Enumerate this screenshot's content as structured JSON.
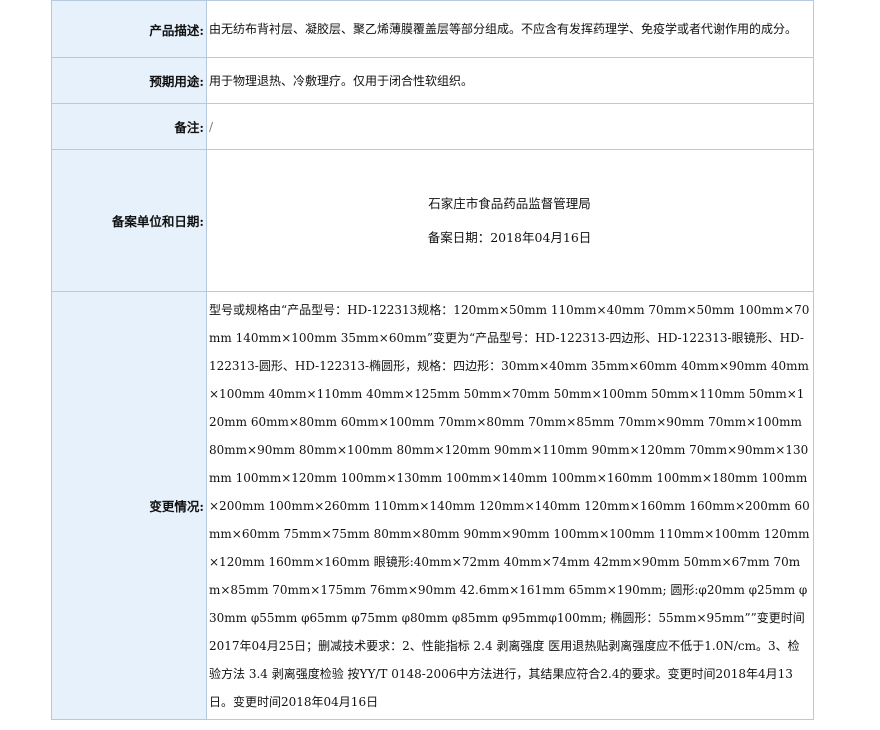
{
  "rows": {
    "product_description": {
      "label": "产品描述:",
      "value": "由无纺布背衬层、凝胶层、聚乙烯薄膜覆盖层等部分组成。不应含有发挥药理学、免疫学或者代谢作用的成分。"
    },
    "intended_use": {
      "label": "预期用途:",
      "value": "用于物理退热、冷敷理疗。仅用于闭合性软组织。"
    },
    "remarks": {
      "label": "备注:",
      "value": "/"
    },
    "filing_unit_date": {
      "label": "备案单位和日期:",
      "unit": "石家庄市食品药品监督管理局",
      "date": "备案日期：2018年04月16日"
    },
    "change_status": {
      "label": "变更情况:",
      "value": "型号或规格由“产品型号：HD-122313规格：120mm×50mm 110mm×40mm 70mm×50mm 100mm×70mm 140mm×100mm 35mm×60mm”变更为“产品型号：HD-122313-四边形、HD-122313-眼镜形、HD-122313-圆形、HD-122313-椭圆形，规格：四边形：30mm×40mm 35mm×60mm 40mm×90mm 40mm×100mm 40mm×110mm 40mm×125mm 50mm×70mm 50mm×100mm 50mm×110mm 50mm×120mm 60mm×80mm 60mm×100mm 70mm×80mm 70mm×85mm 70mm×90mm 70mm×100mm 80mm×90mm 80mm×100mm 80mm×120mm 90mm×110mm 90mm×120mm 70mm×90mm×130mm 100mm×120mm 100mm×130mm 100mm×140mm 100mm×160mm 100mm×180mm 100mm×200mm 100mm×260mm 110mm×140mm 120mm×140mm 120mm×160mm 160mm×200mm 60mm×60mm 75mm×75mm 80mm×80mm 90mm×90mm 100mm×100mm 110mm×100mm 120mm×120mm 160mm×160mm 眼镜形:40mm×72mm 40mm×74mm 42mm×90mm 50mm×67mm 70mm×85mm 70mm×175mm 76mm×90mm 42.6mm×161mm 65mm×190mm; 圆形:φ20mm φ25mm φ30mm φ55mm φ65mm φ75mm φ80mm φ85mm φ95mmφ100mm; 椭圆形：55mm×95mm””变更时间2017年04月25日；删减技术要求：2、性能指标 2.4 剥离强度 医用退热贴剥离强度应不低于1.0N/cm。3、检验方法 3.4 剥离强度检验 按YY/T 0148-2006中方法进行，其结果应符合2.4的要求。变更时间2018年4月13日。变更时间2018年04月16日"
    }
  }
}
